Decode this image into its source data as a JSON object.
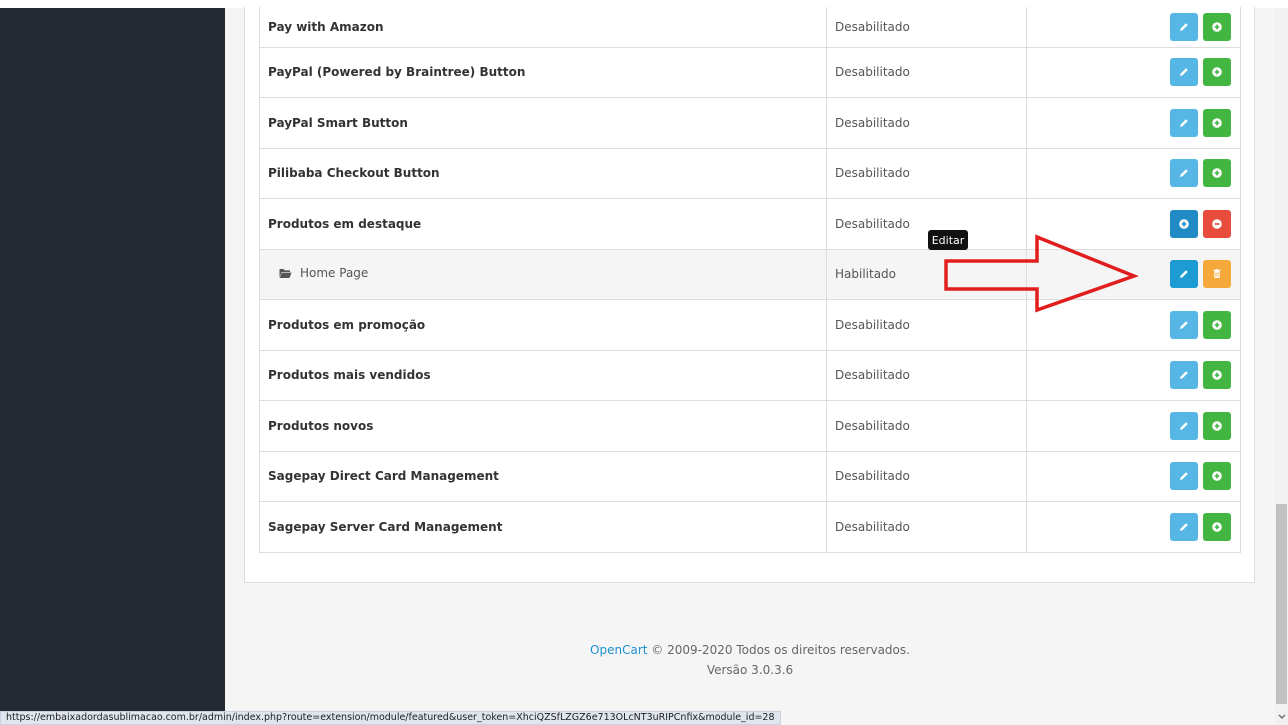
{
  "colors": {
    "sidebar_bg": "#232a32",
    "edit_button": "#56b7e6",
    "edit_button_hover": "#1d9cd4",
    "install_button": "#43b541",
    "add_button": "#1f8ac3",
    "remove_button": "#e74c3c",
    "delete_button": "#f4a93a",
    "annotation_arrow": "#e11e1e",
    "link": "#1e91cf"
  },
  "modules": [
    {
      "name": "Pay with Amazon",
      "status": "Desabilitado",
      "kind": "extension"
    },
    {
      "name": "PayPal (Powered by Braintree) Button",
      "status": "Desabilitado",
      "kind": "extension"
    },
    {
      "name": "PayPal Smart Button",
      "status": "Desabilitado",
      "kind": "extension"
    },
    {
      "name": "Pilibaba Checkout Button",
      "status": "Desabilitado",
      "kind": "extension"
    },
    {
      "name": "Produtos em destaque",
      "status": "Desabilitado",
      "kind": "installed"
    },
    {
      "name": "Home Page",
      "status": "Habilitado",
      "kind": "instance",
      "icon": "folder-open-icon"
    },
    {
      "name": "Produtos em promoção",
      "status": "Desabilitado",
      "kind": "extension"
    },
    {
      "name": "Produtos mais vendidos",
      "status": "Desabilitado",
      "kind": "extension"
    },
    {
      "name": "Produtos novos",
      "status": "Desabilitado",
      "kind": "extension"
    },
    {
      "name": "Sagepay Direct Card Management",
      "status": "Desabilitado",
      "kind": "extension"
    },
    {
      "name": "Sagepay Server Card Management",
      "status": "Desabilitado",
      "kind": "extension"
    }
  ],
  "tooltip": {
    "text": "Editar"
  },
  "footer": {
    "brand": "OpenCart",
    "copyright": "© 2009-2020 Todos os direitos reservados.",
    "version": "Versão 3.0.3.6"
  },
  "statusbar": {
    "url": "https://embaixadordasublimacao.com.br/admin/index.php?route=extension/module/featured&user_token=XhciQZSfLZGZ6e713OLcNT3uRIPCnfix&module_id=28"
  }
}
